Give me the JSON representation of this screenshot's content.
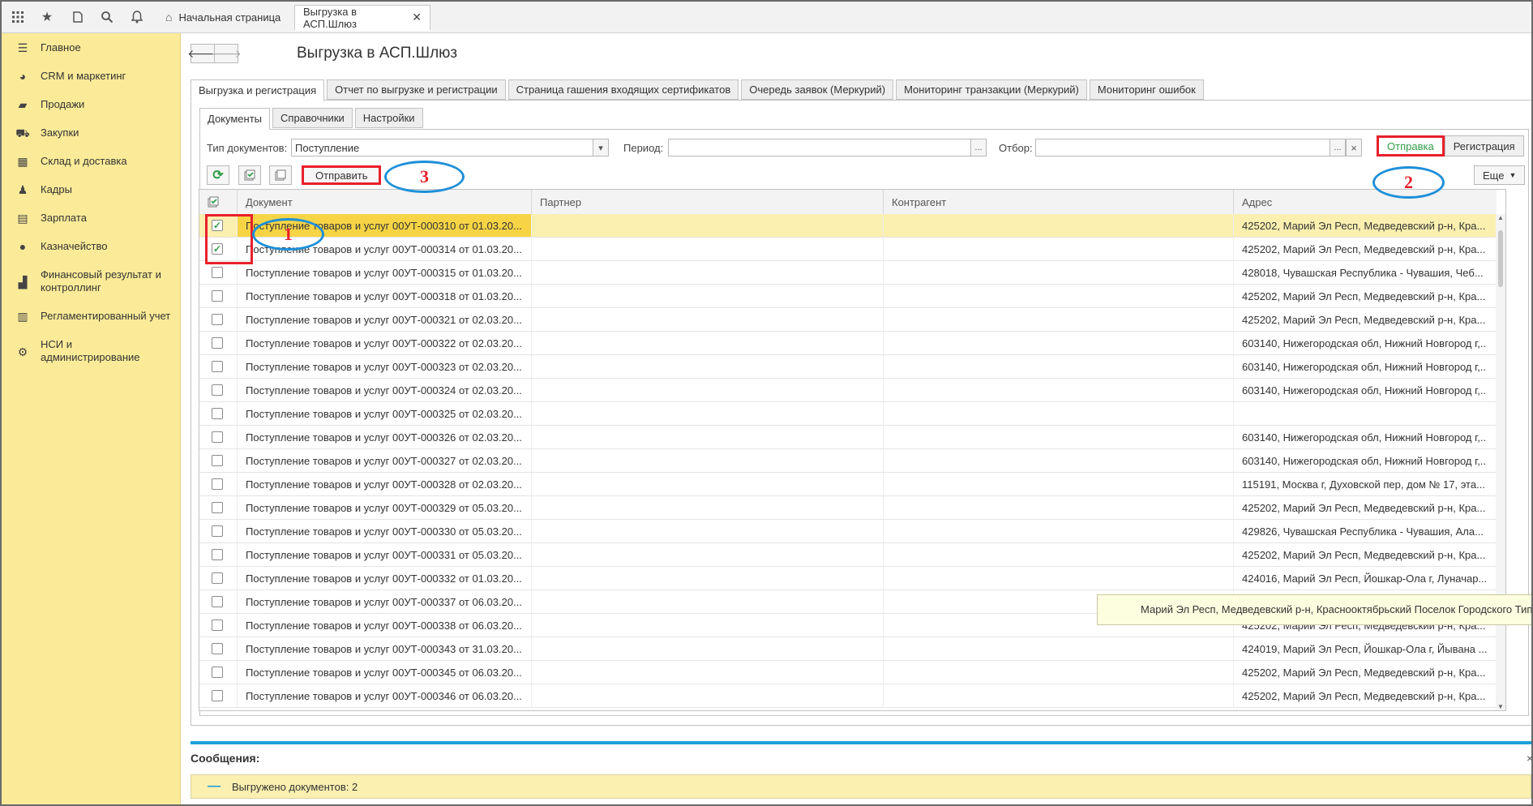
{
  "topbar": {
    "icons": [
      "apps-grid-icon",
      "star-icon",
      "history-icon",
      "search-icon",
      "bell-icon"
    ],
    "home_tab": "Начальная страница",
    "active_tab": "Выгрузка в АСП.Шлюз"
  },
  "sidebar": {
    "items": [
      {
        "label": "Главное",
        "icon": "menu-icon"
      },
      {
        "label": "CRM и маркетинг",
        "icon": "pie-icon"
      },
      {
        "label": "Продажи",
        "icon": "bag-icon"
      },
      {
        "label": "Закупки",
        "icon": "cart-icon"
      },
      {
        "label": "Склад и доставка",
        "icon": "warehouse-icon"
      },
      {
        "label": "Кадры",
        "icon": "people-icon"
      },
      {
        "label": "Зарплата",
        "icon": "calculator-icon"
      },
      {
        "label": "Казначейство",
        "icon": "ruble-icon"
      },
      {
        "label": "Финансовый результат и контроллинг",
        "icon": "chart-icon"
      },
      {
        "label": "Регламентированный учет",
        "icon": "ledger-icon"
      },
      {
        "label": "НСИ и администрирование",
        "icon": "gear-icon"
      }
    ]
  },
  "page": {
    "title": "Выгрузка в АСП.Шлюз"
  },
  "tabs_top": [
    "Выгрузка и регистрация",
    "Отчет по выгрузке и регистрации",
    "Страница гашения входящих сертификатов",
    "Очередь заявок (Меркурий)",
    "Мониторинг транзакции (Меркурий)",
    "Мониторинг ошибок"
  ],
  "tabs_sub": [
    "Документы",
    "Справочники",
    "Настройки"
  ],
  "filters": {
    "doc_type_label": "Тип документов:",
    "doc_type_value": "Поступление",
    "period_label": "Период:",
    "period_value": "",
    "selection_label": "Отбор:",
    "selection_value": "",
    "ellipsis": "...",
    "clear": "×",
    "dropdown": "▾"
  },
  "mode_switch": {
    "send": "Отправка",
    "register": "Регистрация"
  },
  "toolbar": {
    "send_button": "Отправить",
    "more_button": "Еще"
  },
  "annotations": {
    "one": "1",
    "two": "2",
    "three": "3"
  },
  "table": {
    "columns": [
      "Документ",
      "Партнер",
      "Контрагент",
      "Адрес"
    ],
    "rows": [
      {
        "checked": true,
        "doc": "Поступление товаров и услуг 00УТ-000310 от 01.03.20...",
        "partner": "",
        "contragent": "",
        "address": "425202, Марий Эл Респ, Медведевский р-н, Кра..."
      },
      {
        "checked": true,
        "doc": "Поступление товаров и услуг 00УТ-000314 от 01.03.20...",
        "partner": "",
        "contragent": "",
        "address": "425202, Марий Эл Респ, Медведевский р-н, Кра..."
      },
      {
        "checked": false,
        "doc": "Поступление товаров и услуг 00УТ-000315 от 01.03.20...",
        "partner": "",
        "contragent": "",
        "address": "428018, Чувашская Республика - Чувашия, Чеб..."
      },
      {
        "checked": false,
        "doc": "Поступление товаров и услуг 00УТ-000318 от 01.03.20...",
        "partner": "",
        "contragent": "",
        "address": "425202, Марий Эл Респ, Медведевский р-н, Кра..."
      },
      {
        "checked": false,
        "doc": "Поступление товаров и услуг 00УТ-000321 от 02.03.20...",
        "partner": "",
        "contragent": "",
        "address": "425202, Марий Эл Респ, Медведевский р-н, Кра..."
      },
      {
        "checked": false,
        "doc": "Поступление товаров и услуг 00УТ-000322 от 02.03.20...",
        "partner": "",
        "contragent": "",
        "address": "603140, Нижегородская обл, Нижний Новгород г,..."
      },
      {
        "checked": false,
        "doc": "Поступление товаров и услуг 00УТ-000323 от 02.03.20...",
        "partner": "",
        "contragent": "",
        "address": "603140, Нижегородская обл, Нижний Новгород г,..."
      },
      {
        "checked": false,
        "doc": "Поступление товаров и услуг 00УТ-000324 от 02.03.20...",
        "partner": "",
        "contragent": "",
        "address": "603140, Нижегородская обл, Нижний Новгород г,..."
      },
      {
        "checked": false,
        "doc": "Поступление товаров и услуг 00УТ-000325 от 02.03.20...",
        "partner": "",
        "contragent": "",
        "address": ""
      },
      {
        "checked": false,
        "doc": "Поступление товаров и услуг 00УТ-000326 от 02.03.20...",
        "partner": "",
        "contragent": "",
        "address": "603140, Нижегородская обл, Нижний Новгород г,..."
      },
      {
        "checked": false,
        "doc": "Поступление товаров и услуг 00УТ-000327 от 02.03.20...",
        "partner": "",
        "contragent": "",
        "address": "603140, Нижегородская обл, Нижний Новгород г,..."
      },
      {
        "checked": false,
        "doc": "Поступление товаров и услуг 00УТ-000328 от 02.03.20...",
        "partner": "",
        "contragent": "",
        "address": "115191, Москва г, Духовской пер, дом № 17, эта..."
      },
      {
        "checked": false,
        "doc": "Поступление товаров и услуг 00УТ-000329 от 05.03.20...",
        "partner": "",
        "contragent": "",
        "address": "425202, Марий Эл Респ, Медведевский р-н, Кра..."
      },
      {
        "checked": false,
        "doc": "Поступление товаров и услуг 00УТ-000330 от 05.03.20...",
        "partner": "",
        "contragent": "",
        "address": "429826, Чувашская Республика - Чувашия, Ала..."
      },
      {
        "checked": false,
        "doc": "Поступление товаров и услуг 00УТ-000331 от 05.03.20...",
        "partner": "",
        "contragent": "",
        "address": "425202, Марий Эл Респ, Медведевский р-н, Кра..."
      },
      {
        "checked": false,
        "doc": "Поступление товаров и услуг 00УТ-000332 от 01.03.20...",
        "partner": "",
        "contragent": "",
        "address": "424016, Марий Эл Респ, Йошкар-Ола г, Луначар..."
      },
      {
        "checked": false,
        "doc": "Поступление товаров и услуг 00УТ-000337 от 06.03.20...",
        "partner": "",
        "contragent": "",
        "address": ""
      },
      {
        "checked": false,
        "doc": "Поступление товаров и услуг 00УТ-000338 от 06.03.20...",
        "partner": "",
        "contragent": "",
        "address": "425202, Марий Эл Респ, Медведевский р-н, Кра..."
      },
      {
        "checked": false,
        "doc": "Поступление товаров и услуг 00УТ-000343 от 31.03.20...",
        "partner": "",
        "contragent": "",
        "address": "424019, Марий Эл Респ, Йошкар-Ола г, Йывана ..."
      },
      {
        "checked": false,
        "doc": "Поступление товаров и услуг 00УТ-000345 от 06.03.20...",
        "partner": "",
        "contragent": "",
        "address": "425202, Марий Эл Респ, Медведевский р-н, Кра..."
      },
      {
        "checked": false,
        "doc": "Поступление товаров и услуг 00УТ-000346 от 06.03.20...",
        "partner": "",
        "contragent": "",
        "address": "425202, Марий Эл Респ, Медведевский р-н, Кра..."
      }
    ]
  },
  "tooltip": "Марий Эл Респ, Медведевский р-н, Краснооктябрьский Поселок Городского Типа",
  "messages": {
    "title": "Сообщения:",
    "close": "×",
    "text": "Выгружено документов: 2"
  },
  "colors": {
    "sidebar": "#fbeb98",
    "selected_row": "#fbf0b0",
    "selected_cell": "#f6d445",
    "annotation_red": "#e8202a",
    "annotation_blue": "#1e90d8",
    "accent": "#1aa0db",
    "active_mode": "#2e9e47"
  }
}
